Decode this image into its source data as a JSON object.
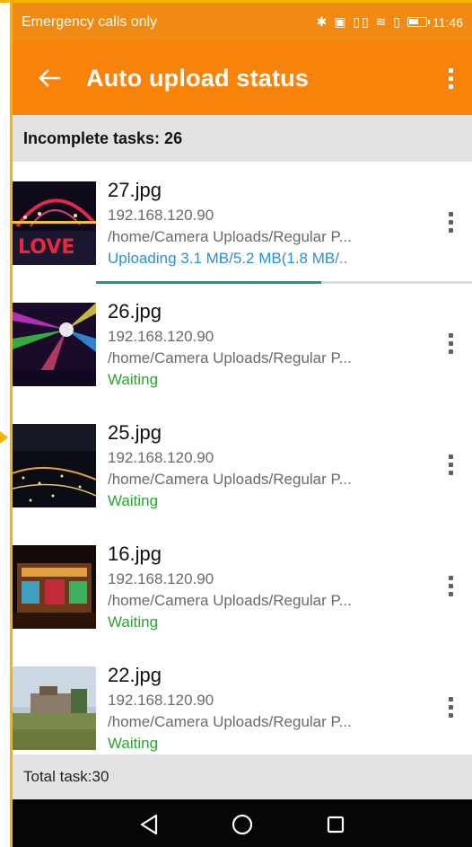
{
  "status_bar": {
    "left_text": "Emergency calls only",
    "icons_text": "✱ ▣ ▯▯ ≋ ▯",
    "time": "11:46"
  },
  "app_bar": {
    "back_icon": "arrow-left-icon",
    "title": "Auto upload status",
    "menu_icon": "more-vertical-icon"
  },
  "section_header": "Incomplete tasks: 26",
  "tasks": [
    {
      "name": "27.jpg",
      "host": "192.168.120.90",
      "path": "/home/Camera Uploads/Regular P...",
      "status": "Uploading  3.1 MB/5.2 MB(1.8 MB/..",
      "state": "uploading",
      "progress": 0.6
    },
    {
      "name": "26.jpg",
      "host": "192.168.120.90",
      "path": "/home/Camera Uploads/Regular P...",
      "status": "Waiting",
      "state": "waiting"
    },
    {
      "name": "25.jpg",
      "host": "192.168.120.90",
      "path": "/home/Camera Uploads/Regular P...",
      "status": "Waiting",
      "state": "waiting"
    },
    {
      "name": "16.jpg",
      "host": "192.168.120.90",
      "path": "/home/Camera Uploads/Regular P...",
      "status": "Waiting",
      "state": "waiting"
    },
    {
      "name": "22.jpg",
      "host": "192.168.120.90",
      "path": "/home/Camera Uploads/Regular P...",
      "status": "Waiting",
      "state": "waiting"
    }
  ],
  "footer": "Total task:30",
  "nav": {
    "back_icon": "triangle-back-icon",
    "home_icon": "circle-home-icon",
    "recents_icon": "square-recents-icon"
  },
  "colors": {
    "status_bar": "#f08a12",
    "app_bar": "#f7830a",
    "waiting": "#2aa52f",
    "uploading": "#2a8fd6",
    "progress": "#1b9a8a",
    "frame_highlight": "#f7b300"
  }
}
